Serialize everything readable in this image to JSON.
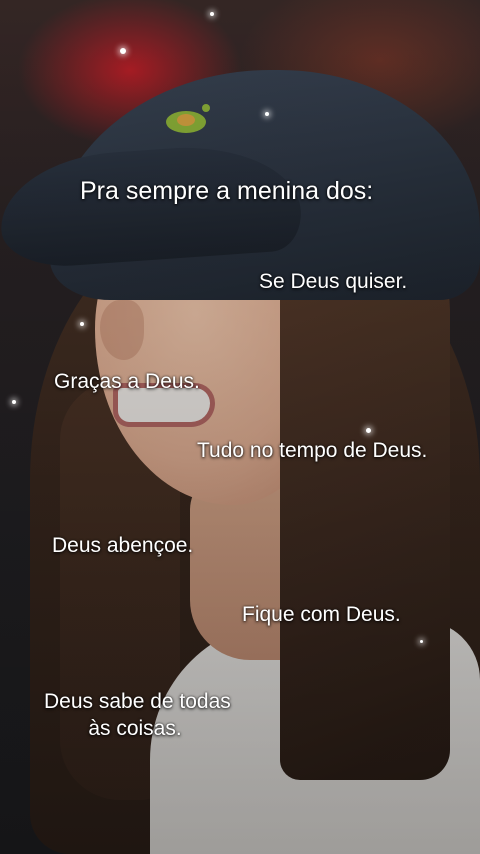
{
  "overlay": {
    "title": "Pra sempre a menina dos:",
    "phrases": [
      "Se Deus quiser.",
      "Graças a Deus.",
      "Tudo no tempo de Deus.",
      "Deus abençoe.",
      "Fique com Deus."
    ],
    "last_line_1": "Deus sabe de todas",
    "last_line_2": "às coisas."
  }
}
